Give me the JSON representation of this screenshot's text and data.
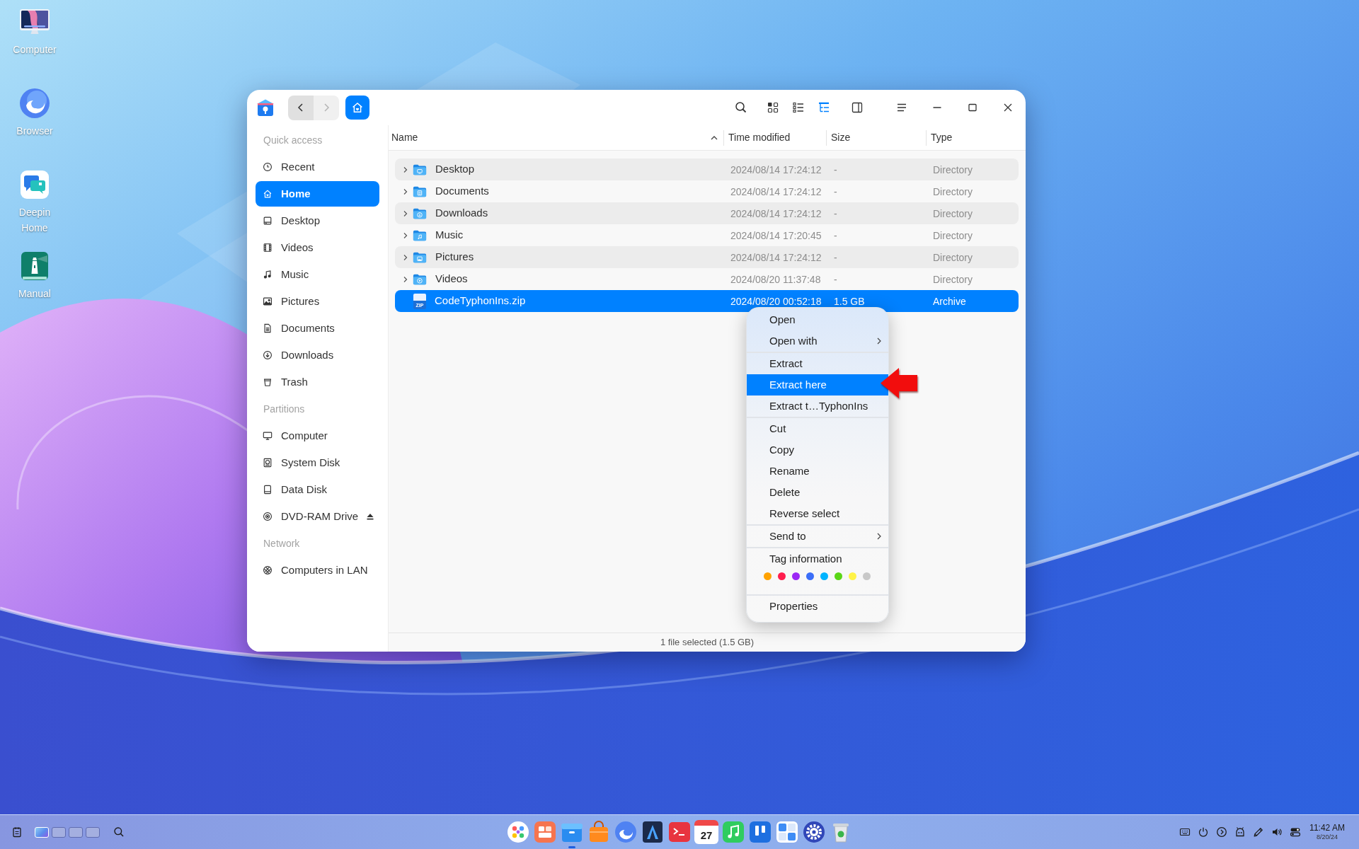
{
  "desktop_icons": [
    {
      "label": "Computer",
      "kind": "computer"
    },
    {
      "label": "Browser",
      "kind": "browser"
    },
    {
      "label": "Deepin Home",
      "kind": "deepin-home"
    },
    {
      "label": "Manual",
      "kind": "manual"
    }
  ],
  "window": {
    "toolbar": {
      "back": {
        "disabled": false
      },
      "forward": {
        "disabled": true
      },
      "view_modes": [
        {
          "kind": "icons",
          "selected": false
        },
        {
          "kind": "list",
          "selected": false
        },
        {
          "kind": "tree",
          "selected": true
        }
      ]
    },
    "sidebar": {
      "groups": [
        {
          "title": "Quick access",
          "items": [
            {
              "label": "Recent",
              "kind": "recent",
              "selected": false,
              "eject": false
            },
            {
              "label": "Home",
              "kind": "home",
              "selected": true,
              "eject": false
            },
            {
              "label": "Desktop",
              "kind": "desktop",
              "selected": false,
              "eject": false
            },
            {
              "label": "Videos",
              "kind": "videos",
              "selected": false,
              "eject": false
            },
            {
              "label": "Music",
              "kind": "music",
              "selected": false,
              "eject": false
            },
            {
              "label": "Pictures",
              "kind": "pictures",
              "selected": false,
              "eject": false
            },
            {
              "label": "Documents",
              "kind": "documents",
              "selected": false,
              "eject": false
            },
            {
              "label": "Downloads",
              "kind": "downloads",
              "selected": false,
              "eject": false
            },
            {
              "label": "Trash",
              "kind": "trash",
              "selected": false,
              "eject": false
            }
          ]
        },
        {
          "title": "Partitions",
          "items": [
            {
              "label": "Computer",
              "kind": "computer",
              "selected": false,
              "eject": false
            },
            {
              "label": "System Disk",
              "kind": "system-disk",
              "selected": false,
              "eject": false
            },
            {
              "label": "Data Disk",
              "kind": "data-disk",
              "selected": false,
              "eject": false
            },
            {
              "label": "DVD-RAM Drive",
              "kind": "dvd",
              "selected": false,
              "eject": true
            }
          ]
        },
        {
          "title": "Network",
          "items": [
            {
              "label": "Computers in LAN",
              "kind": "network",
              "selected": false,
              "eject": false
            }
          ]
        }
      ]
    },
    "table": {
      "columns": [
        {
          "label": "Name",
          "sorted": true
        },
        {
          "label": "Time modified",
          "sorted": false
        },
        {
          "label": "Size",
          "sorted": false
        },
        {
          "label": "Type",
          "sorted": false
        }
      ],
      "rows": [
        {
          "name": "Desktop",
          "kind": "desktop-folder",
          "expanded": false,
          "time_modified": "2024/08/14 17:24:12",
          "size": "-",
          "type": "Directory",
          "selected": false
        },
        {
          "name": "Documents",
          "kind": "documents-folder",
          "expanded": false,
          "time_modified": "2024/08/14 17:24:12",
          "size": "-",
          "type": "Directory",
          "selected": false
        },
        {
          "name": "Downloads",
          "kind": "downloads-folder",
          "expanded": false,
          "time_modified": "2024/08/14 17:24:12",
          "size": "-",
          "type": "Directory",
          "selected": false
        },
        {
          "name": "Music",
          "kind": "music-folder",
          "expanded": false,
          "time_modified": "2024/08/14 17:20:45",
          "size": "-",
          "type": "Directory",
          "selected": false
        },
        {
          "name": "Pictures",
          "kind": "pictures-folder",
          "expanded": false,
          "time_modified": "2024/08/14 17:24:12",
          "size": "-",
          "type": "Directory",
          "selected": false
        },
        {
          "name": "Videos",
          "kind": "videos-folder",
          "expanded": false,
          "time_modified": "2024/08/20 11:37:48",
          "size": "-",
          "type": "Directory",
          "selected": false
        },
        {
          "name": "CodeTyphonIns.zip",
          "kind": "archive",
          "icon_text": "ZIP",
          "time_modified": "2024/08/20 00:52:18",
          "size": "1.5 GB",
          "type": "Archive",
          "selected": true
        }
      ]
    },
    "status_bar": "1 file selected (1.5 GB)"
  },
  "context_menu": {
    "items": [
      {
        "kind": "item",
        "label": "Open",
        "submenu": false,
        "selected": false
      },
      {
        "kind": "item",
        "label": "Open with",
        "submenu": true,
        "selected": false
      },
      {
        "kind": "separator"
      },
      {
        "kind": "item",
        "label": "Extract",
        "submenu": false,
        "selected": false
      },
      {
        "kind": "item",
        "label": "Extract here",
        "submenu": false,
        "selected": true
      },
      {
        "kind": "item",
        "label": "Extract t…TyphonIns",
        "submenu": false,
        "selected": false
      },
      {
        "kind": "separator"
      },
      {
        "kind": "item",
        "label": "Cut",
        "submenu": false,
        "selected": false
      },
      {
        "kind": "item",
        "label": "Copy",
        "submenu": false,
        "selected": false
      },
      {
        "kind": "item",
        "label": "Rename",
        "submenu": false,
        "selected": false
      },
      {
        "kind": "item",
        "label": "Delete",
        "submenu": false,
        "selected": false
      },
      {
        "kind": "item",
        "label": "Reverse select",
        "submenu": false,
        "selected": false
      },
      {
        "kind": "separator"
      },
      {
        "kind": "item",
        "label": "Send to",
        "submenu": true,
        "selected": false
      },
      {
        "kind": "separator"
      },
      {
        "kind": "tags",
        "label": "Tag information",
        "tags": [
          {
            "color": "#ffa200"
          },
          {
            "color": "#ff1e4e"
          },
          {
            "color": "#9b28f5"
          },
          {
            "color": "#3b6ef8"
          },
          {
            "color": "#00b4ff"
          },
          {
            "color": "#5ad617"
          },
          {
            "color": "#fff347"
          },
          {
            "color": "#c8c8c8"
          }
        ]
      },
      {
        "kind": "separator"
      },
      {
        "kind": "item",
        "label": "Properties",
        "submenu": false,
        "selected": false
      }
    ]
  },
  "taskbar": {
    "workspaces": [
      {
        "selected": true
      },
      {
        "selected": false
      },
      {
        "selected": false
      },
      {
        "selected": false
      }
    ],
    "dock": [
      {
        "kind": "launcher",
        "active": false
      },
      {
        "kind": "tiles",
        "active": false
      },
      {
        "kind": "file-manager",
        "active": true
      },
      {
        "kind": "bag",
        "active": false
      },
      {
        "kind": "browser",
        "active": false
      },
      {
        "kind": "triangle",
        "active": false
      },
      {
        "kind": "terminal",
        "active": false
      },
      {
        "kind": "calendar",
        "text": "27",
        "active": false
      },
      {
        "kind": "music",
        "active": false
      },
      {
        "kind": "bars-tile",
        "active": false
      },
      {
        "kind": "grid",
        "active": false
      },
      {
        "kind": "settings",
        "active": false
      },
      {
        "kind": "trash",
        "active": false
      }
    ],
    "tray": [
      {
        "kind": "keyboard"
      },
      {
        "kind": "power"
      },
      {
        "kind": "circle-arrow"
      },
      {
        "kind": "robot"
      },
      {
        "kind": "pen"
      },
      {
        "kind": "volume"
      },
      {
        "kind": "toggles"
      }
    ],
    "time": "11:42 AM",
    "date": "8/20/24"
  }
}
